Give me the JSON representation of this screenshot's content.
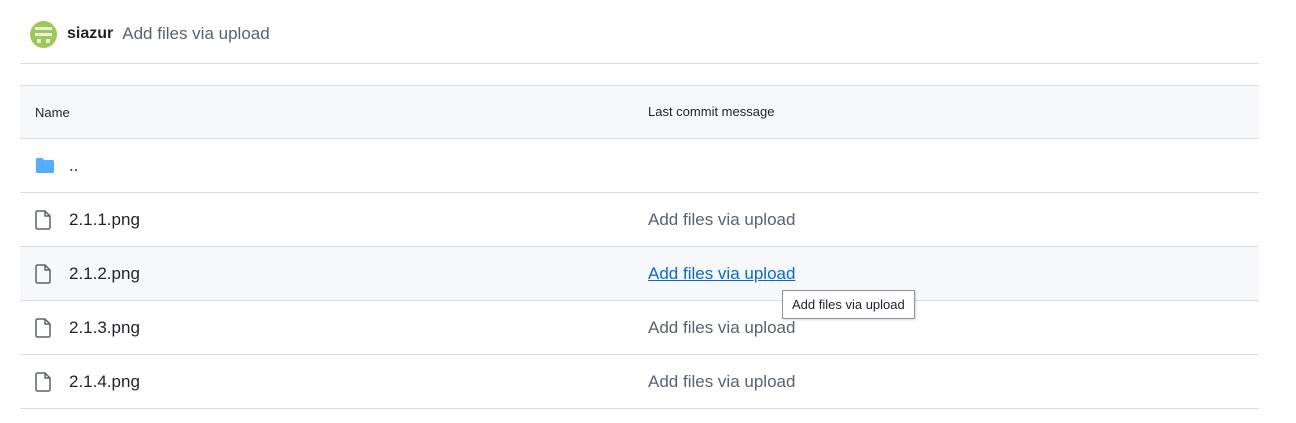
{
  "commit": {
    "author": "siazur",
    "message": "Add files via upload"
  },
  "table": {
    "headers": {
      "name": "Name",
      "message": "Last commit message"
    },
    "parent_dir": "..",
    "rows": [
      {
        "name": "2.1.1.png",
        "message": "Add files via upload"
      },
      {
        "name": "2.1.2.png",
        "message": "Add files via upload"
      },
      {
        "name": "2.1.3.png",
        "message": "Add files via upload"
      },
      {
        "name": "2.1.4.png",
        "message": "Add files via upload"
      }
    ]
  },
  "tooltip": {
    "text": "Add files via upload"
  },
  "icons": {
    "folder": "folder-icon",
    "file": "file-icon",
    "avatar": "avatar"
  },
  "colors": {
    "folder": "#54aeff",
    "link": "#0969da",
    "muted": "#59636e",
    "header_bg": "#f6f8fa",
    "avatar": "#9fc85a"
  }
}
